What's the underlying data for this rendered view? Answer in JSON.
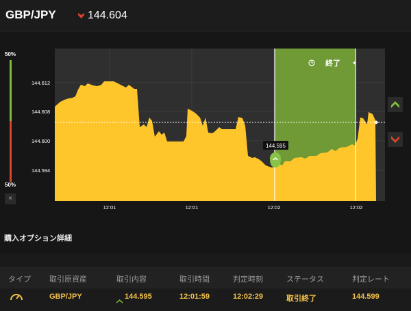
{
  "header": {
    "pair": "GBP/JPY",
    "price": "144.604",
    "trend_icon": "down-arrow-icon",
    "trend_color": "#d9452b"
  },
  "ratio": {
    "high_percent": "50%",
    "low_percent": "50%",
    "close_label": "×",
    "high_fraction": 0.5,
    "high_color": "#7fbe3c",
    "low_color": "#d9452b"
  },
  "chart_data": {
    "type": "area",
    "y_ticks": [
      "144.612",
      "144.608",
      "144.600",
      "144.594"
    ],
    "y_tick_values": [
      144.612,
      144.608,
      144.6,
      144.594
    ],
    "x_ticks": [
      "12:01",
      "12:01",
      "12:02",
      "12:02"
    ],
    "period_label": "終了",
    "tooltip_value": "144.595",
    "current_rate": 144.604,
    "fill_color": "#ffc62b",
    "period_color": "#6f9a36"
  },
  "controls": {
    "up_icon": "high-arrow-icon",
    "down_icon": "low-arrow-icon",
    "up_color": "#7fbe3c",
    "down_color": "#d9452b"
  },
  "details": {
    "title": "購入オプション詳細",
    "columns": [
      "タイプ",
      "取引原資産",
      "取引内容",
      "取引時間",
      "判定時刻",
      "ステータス",
      "判定レート"
    ],
    "row": {
      "type_icon": "gauge-icon",
      "asset": "GBP/JPY",
      "content": "144.595",
      "trade_time": "12:01:59",
      "judge_time": "12:02:29",
      "status": "取引終了",
      "judge_rate": "144.599"
    }
  }
}
